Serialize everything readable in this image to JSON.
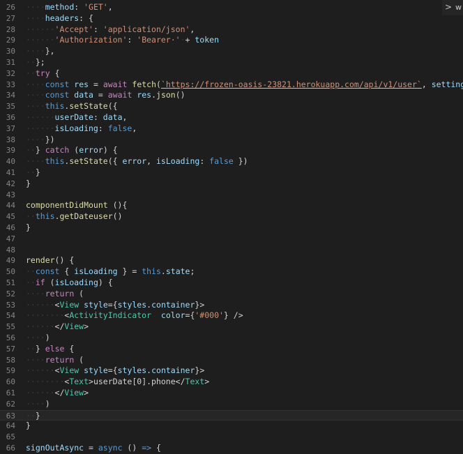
{
  "editor": {
    "lines": [
      {
        "n": "26",
        "segs": [
          [
            "ws",
            "····"
          ],
          [
            "var",
            "method"
          ],
          [
            "punc",
            ": "
          ],
          [
            "str",
            "'GET'"
          ],
          [
            "punc",
            ","
          ]
        ]
      },
      {
        "n": "27",
        "segs": [
          [
            "ws",
            "····"
          ],
          [
            "var",
            "headers"
          ],
          [
            "punc",
            ": {"
          ]
        ]
      },
      {
        "n": "28",
        "segs": [
          [
            "ws",
            "······"
          ],
          [
            "str",
            "'Accept'"
          ],
          [
            "punc",
            ": "
          ],
          [
            "str",
            "'application/json'"
          ],
          [
            "punc",
            ","
          ]
        ]
      },
      {
        "n": "29",
        "segs": [
          [
            "ws",
            "······"
          ],
          [
            "str",
            "'Authorization'"
          ],
          [
            "punc",
            ": "
          ],
          [
            "str",
            "'Bearer·'"
          ],
          [
            "ws",
            "·"
          ],
          [
            "punc",
            "+ "
          ],
          [
            "var",
            "token"
          ]
        ]
      },
      {
        "n": "30",
        "segs": [
          [
            "ws",
            "····"
          ],
          [
            "punc",
            "},"
          ]
        ]
      },
      {
        "n": "31",
        "segs": [
          [
            "ws",
            "··"
          ],
          [
            "punc",
            "};"
          ]
        ]
      },
      {
        "n": "32",
        "segs": [
          [
            "ws",
            "··"
          ],
          [
            "ctl",
            "try"
          ],
          [
            "punc",
            " {"
          ]
        ]
      },
      {
        "n": "33",
        "segs": [
          [
            "ws",
            "····"
          ],
          [
            "kw",
            "const"
          ],
          [
            "punc",
            " "
          ],
          [
            "var",
            "res"
          ],
          [
            "punc",
            " = "
          ],
          [
            "ctl",
            "await"
          ],
          [
            "punc",
            " "
          ],
          [
            "fn",
            "fetch"
          ],
          [
            "punc",
            "("
          ],
          [
            "str",
            "`https://frozen-oasis-23821.herokuapp.com/api/v1/user`"
          ],
          [
            "punc",
            ", "
          ],
          [
            "var",
            "settings"
          ],
          [
            "punc",
            ");"
          ]
        ]
      },
      {
        "n": "34",
        "segs": [
          [
            "ws",
            "····"
          ],
          [
            "kw",
            "const"
          ],
          [
            "punc",
            " "
          ],
          [
            "var",
            "data"
          ],
          [
            "punc",
            " = "
          ],
          [
            "ctl",
            "await"
          ],
          [
            "punc",
            " "
          ],
          [
            "var",
            "res"
          ],
          [
            "punc",
            "."
          ],
          [
            "fn",
            "json"
          ],
          [
            "punc",
            "()"
          ]
        ]
      },
      {
        "n": "35",
        "segs": [
          [
            "ws",
            "····"
          ],
          [
            "kw",
            "this"
          ],
          [
            "punc",
            "."
          ],
          [
            "fn",
            "setState"
          ],
          [
            "punc",
            "({"
          ]
        ]
      },
      {
        "n": "36",
        "segs": [
          [
            "ws",
            "······"
          ],
          [
            "var",
            "userDate"
          ],
          [
            "punc",
            ": "
          ],
          [
            "var",
            "data"
          ],
          [
            "punc",
            ","
          ]
        ]
      },
      {
        "n": "37",
        "segs": [
          [
            "ws",
            "······"
          ],
          [
            "var",
            "isLoading"
          ],
          [
            "punc",
            ": "
          ],
          [
            "bool",
            "false"
          ],
          [
            "punc",
            ","
          ]
        ]
      },
      {
        "n": "38",
        "segs": [
          [
            "ws",
            "····"
          ],
          [
            "punc",
            "})"
          ]
        ]
      },
      {
        "n": "39",
        "segs": [
          [
            "ws",
            "··"
          ],
          [
            "punc",
            "} "
          ],
          [
            "ctl",
            "catch"
          ],
          [
            "punc",
            " ("
          ],
          [
            "var",
            "error"
          ],
          [
            "punc",
            ") {"
          ]
        ]
      },
      {
        "n": "40",
        "segs": [
          [
            "ws",
            "····"
          ],
          [
            "kw",
            "this"
          ],
          [
            "punc",
            "."
          ],
          [
            "fn",
            "setState"
          ],
          [
            "punc",
            "({ "
          ],
          [
            "var",
            "error"
          ],
          [
            "punc",
            ", "
          ],
          [
            "var",
            "isLoading"
          ],
          [
            "punc",
            ": "
          ],
          [
            "bool",
            "false"
          ],
          [
            "punc",
            " })"
          ]
        ]
      },
      {
        "n": "41",
        "segs": [
          [
            "ws",
            "··"
          ],
          [
            "punc",
            "}"
          ]
        ]
      },
      {
        "n": "42",
        "segs": [
          [
            "punc",
            "}"
          ]
        ]
      },
      {
        "n": "43",
        "segs": []
      },
      {
        "n": "44",
        "segs": [
          [
            "fn",
            "componentDidMount"
          ],
          [
            "punc",
            " (){"
          ]
        ]
      },
      {
        "n": "45",
        "segs": [
          [
            "ws",
            "··"
          ],
          [
            "kw",
            "this"
          ],
          [
            "punc",
            "."
          ],
          [
            "fn",
            "getDateuser"
          ],
          [
            "punc",
            "()"
          ]
        ]
      },
      {
        "n": "46",
        "segs": [
          [
            "punc",
            "}"
          ]
        ]
      },
      {
        "n": "47",
        "segs": []
      },
      {
        "n": "48",
        "segs": []
      },
      {
        "n": "49",
        "segs": [
          [
            "fn",
            "render"
          ],
          [
            "punc",
            "() {"
          ]
        ]
      },
      {
        "n": "50",
        "segs": [
          [
            "ws",
            "··"
          ],
          [
            "kw",
            "const"
          ],
          [
            "punc",
            " { "
          ],
          [
            "var",
            "isLoading"
          ],
          [
            "punc",
            " } = "
          ],
          [
            "kw",
            "this"
          ],
          [
            "punc",
            "."
          ],
          [
            "var",
            "state"
          ],
          [
            "punc",
            ";"
          ]
        ]
      },
      {
        "n": "51",
        "segs": [
          [
            "ws",
            "··"
          ],
          [
            "ctl",
            "if"
          ],
          [
            "punc",
            " ("
          ],
          [
            "var",
            "isLoading"
          ],
          [
            "punc",
            ") {"
          ]
        ]
      },
      {
        "n": "52",
        "segs": [
          [
            "ws",
            "····"
          ],
          [
            "ctl",
            "return"
          ],
          [
            "punc",
            " ("
          ]
        ]
      },
      {
        "n": "53",
        "segs": [
          [
            "ws",
            "······"
          ],
          [
            "punc",
            "<"
          ],
          [
            "comp",
            "View"
          ],
          [
            "punc",
            " "
          ],
          [
            "attr",
            "style"
          ],
          [
            "punc",
            "={"
          ],
          [
            "var",
            "styles"
          ],
          [
            "punc",
            "."
          ],
          [
            "var",
            "container"
          ],
          [
            "punc",
            "}>"
          ]
        ]
      },
      {
        "n": "54",
        "segs": [
          [
            "ws",
            "········"
          ],
          [
            "punc",
            "<"
          ],
          [
            "comp",
            "ActivityIndicator"
          ],
          [
            "punc",
            "  "
          ],
          [
            "attr",
            "color"
          ],
          [
            "punc",
            "={"
          ],
          [
            "str",
            "'#000'"
          ],
          [
            "punc",
            "} />"
          ]
        ]
      },
      {
        "n": "55",
        "segs": [
          [
            "ws",
            "······"
          ],
          [
            "punc",
            "</"
          ],
          [
            "comp",
            "View"
          ],
          [
            "punc",
            ">"
          ]
        ]
      },
      {
        "n": "56",
        "segs": [
          [
            "ws",
            "····"
          ],
          [
            "punc",
            ")"
          ]
        ]
      },
      {
        "n": "57",
        "segs": [
          [
            "ws",
            "··"
          ],
          [
            "punc",
            "} "
          ],
          [
            "ctl",
            "else"
          ],
          [
            "punc",
            " {"
          ]
        ]
      },
      {
        "n": "58",
        "segs": [
          [
            "ws",
            "····"
          ],
          [
            "ctl",
            "return"
          ],
          [
            "punc",
            " ("
          ]
        ]
      },
      {
        "n": "59",
        "segs": [
          [
            "ws",
            "······"
          ],
          [
            "punc",
            "<"
          ],
          [
            "comp",
            "View"
          ],
          [
            "punc",
            " "
          ],
          [
            "attr",
            "style"
          ],
          [
            "punc",
            "={"
          ],
          [
            "var",
            "styles"
          ],
          [
            "punc",
            "."
          ],
          [
            "var",
            "container"
          ],
          [
            "punc",
            "}>"
          ]
        ]
      },
      {
        "n": "60",
        "segs": [
          [
            "ws",
            "········"
          ],
          [
            "punc",
            "<"
          ],
          [
            "comp",
            "Text"
          ],
          [
            "punc",
            ">userDate[0].phone</"
          ],
          [
            "comp",
            "Text"
          ],
          [
            "punc",
            ">"
          ]
        ]
      },
      {
        "n": "61",
        "segs": [
          [
            "ws",
            "······"
          ],
          [
            "punc",
            "</"
          ],
          [
            "comp",
            "View"
          ],
          [
            "punc",
            ">"
          ]
        ]
      },
      {
        "n": "62",
        "segs": [
          [
            "ws",
            "····"
          ],
          [
            "punc",
            ")"
          ]
        ]
      },
      {
        "n": "63",
        "segs": [
          [
            "ws",
            "··"
          ],
          [
            "punc",
            "}"
          ]
        ],
        "current": true
      },
      {
        "n": "64",
        "segs": [
          [
            "punc",
            "}"
          ]
        ]
      },
      {
        "n": "65",
        "segs": []
      },
      {
        "n": "66",
        "segs": [
          [
            "var",
            "signOutAsync"
          ],
          [
            "punc",
            " = "
          ],
          [
            "kw",
            "async"
          ],
          [
            "punc",
            " () "
          ],
          [
            "kw",
            "=>"
          ],
          [
            "punc",
            " {"
          ]
        ]
      }
    ]
  },
  "minimap_tab": {
    "chevron": ">",
    "label": "w"
  },
  "colors": {
    "background": "#1e1e1e",
    "keyword": "#569cd6",
    "control": "#c586c0",
    "string": "#ce9178",
    "function": "#dcdcaa",
    "variable": "#9cdcfe",
    "component": "#4ec9b0",
    "gutter": "#858585"
  }
}
